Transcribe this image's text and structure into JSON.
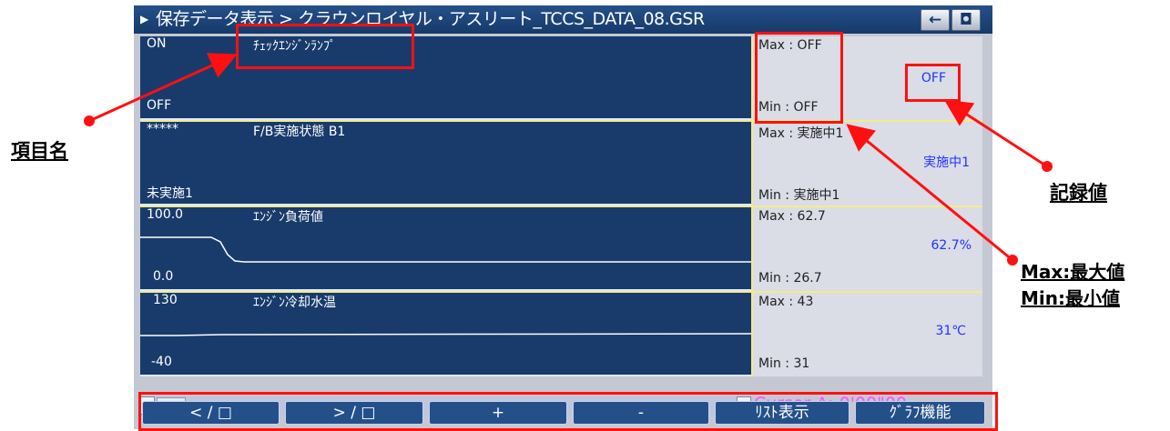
{
  "title": "保存データ表示 > クラウンロイヤル・アスリート_TCCS_DATA_08.GSR",
  "title_buttons": [
    {
      "icon": "back-arrow-icon",
      "glyph": "←"
    },
    {
      "icon": "camera-icon",
      "glyph": "◘"
    }
  ],
  "rows": [
    {
      "max_label": "ON",
      "min_label": "OFF",
      "name": "ﾁｪｯｸｴﾝｼﾞﾝﾗﾝﾌﾟ",
      "max_text": "Max : OFF",
      "min_text": "Min : OFF",
      "current": "OFF"
    },
    {
      "max_label": "*****",
      "min_label": "未実施1",
      "name": "F/B実施状態 B1",
      "max_text": "Max : 実施中1",
      "min_text": "Min : 実施中1",
      "current": "実施中1"
    },
    {
      "max_label": "100.0",
      "min_label": "0.0",
      "name": "ｴﾝｼﾞﾝ負荷値",
      "max_text": "Max : 62.7",
      "min_text": "Min : 26.7",
      "current": "62.7%"
    },
    {
      "max_label": "130",
      "min_label": "-40",
      "name": "ｴﾝｼﾞﾝ冷却水温",
      "max_text": "Max : 43",
      "min_text": "Min : 31",
      "current": "31℃"
    }
  ],
  "cursor_readout": "Cursor A: 0'00\"00",
  "function_buttons": [
    "< / □",
    "> / □",
    "+",
    "-",
    "ﾘｽﾄ表示",
    "ｸﾞﾗﾌ機能"
  ],
  "annotations": {
    "item_name": "項目名",
    "recorded_value": "記録値",
    "max_note": "Max:最大値",
    "min_note": "Min:最小値"
  },
  "colors": {
    "graph_bg": "#183b6b",
    "side_bg": "#dadce6",
    "separator": "#f3ec8a",
    "value_text": "#1f34ff",
    "cursor_text": "#ff50ff",
    "highlight": "#ff1010"
  }
}
